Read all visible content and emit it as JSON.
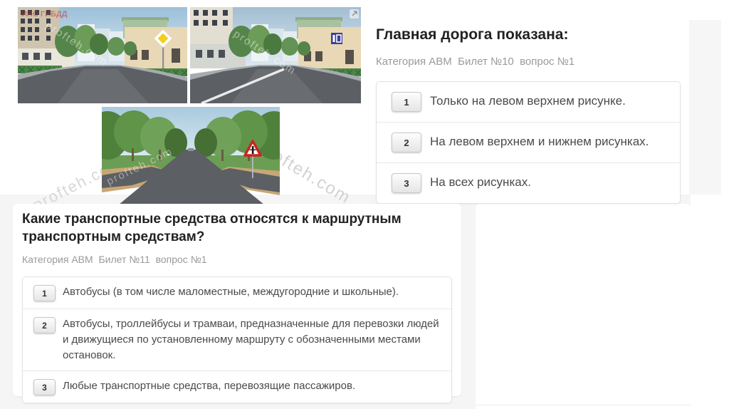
{
  "watermarks": {
    "brand": "profteh.com",
    "brand_partial": "ofteh.com",
    "stamp": "ИНС ГИБДД"
  },
  "images": {
    "top_left": {
      "description": "street intersection scene",
      "sign_icon": "priority-main-road-diamond-sign"
    },
    "top_right": {
      "description": "street intersection scene with white road marking line",
      "sign_icon": "blue-square-regulatory-sign",
      "corner_icon": "expand-icon"
    },
    "bottom": {
      "description": "tree-lined road crossing",
      "sign_icon": "crossing-minor-road-warning-triangle-sign"
    }
  },
  "questions": [
    {
      "title": "Главная дорога показана:",
      "meta": "Категория АВМ  Билет №10  вопрос №1",
      "answers": [
        {
          "num": "1",
          "text": "Только на левом верхнем рисунке."
        },
        {
          "num": "2",
          "text": "На левом верхнем и нижнем рисунках."
        },
        {
          "num": "3",
          "text": "На всех рисунках."
        }
      ]
    },
    {
      "title": "Какие транспортные средства относятся к маршрутным транспортным средствам?",
      "meta": "Категория АВМ  Билет №11  вопрос №1",
      "answers": [
        {
          "num": "1",
          "text": "Автобусы (в том числе маломестные, междугородние и школьные)."
        },
        {
          "num": "2",
          "text": "Автобусы, троллейбусы и трамваи, предназначенные для перевозки людей и движущиеся по установленному маршруту с обозначенными местами остановок."
        },
        {
          "num": "3",
          "text": "Любые транспортные средства, перевозящие пассажиров."
        }
      ]
    }
  ]
}
